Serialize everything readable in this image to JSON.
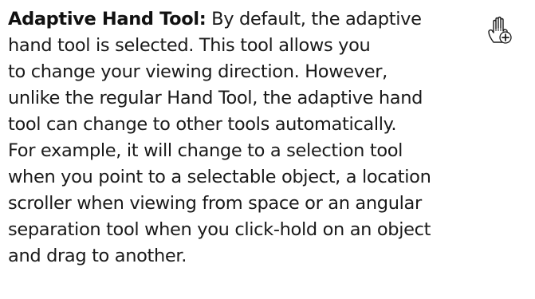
{
  "entry": {
    "term": "Adaptive Hand Tool:",
    "lines": [
      " By default, the adaptive",
      "hand tool is selected. This tool allows you",
      "to change your viewing direction. However,",
      "unlike the regular Hand Tool, the adaptive hand",
      "tool can change to other tools automatically.",
      "For example, it will change to a selection tool",
      "when you point to a selectable object, a location",
      "scroller when viewing from space or an angular",
      "separation tool when you click-hold on an object",
      "and drag to another."
    ],
    "icon": "adaptive-hand-tool-icon"
  }
}
